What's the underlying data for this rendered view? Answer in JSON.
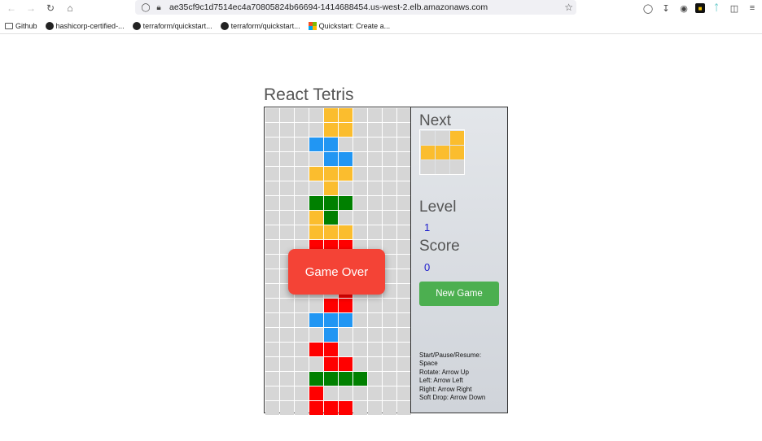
{
  "browser": {
    "url": "ae35cf9c1d7514ec4a70805824b66694-1414688454.us-west-2.elb.amazonaws.com",
    "bookmarks": [
      {
        "label": "Github",
        "icon": "folder-icon"
      },
      {
        "label": "hashicorp-certified-...",
        "icon": "github-icon"
      },
      {
        "label": "terraform/quickstart...",
        "icon": "github-icon"
      },
      {
        "label": "terraform/quickstart...",
        "icon": "github-icon"
      },
      {
        "label": "Quickstart: Create a...",
        "icon": "microsoft-icon"
      }
    ]
  },
  "game": {
    "title": "React Tetris",
    "next_label": "Next",
    "level_label": "Level",
    "level_value": "1",
    "score_label": "Score",
    "score_value": "0",
    "new_game_label": "New Game",
    "game_over_label": "Game Over",
    "controls": [
      "Start/Pause/Resume:",
      "Space",
      "Rotate: Arrow Up",
      "Left: Arrow Left",
      "Right: Arrow Right",
      "Soft Drop: Arrow Down"
    ]
  },
  "colors": {
    "empty": "#d6d6d6",
    "yellow": "#fbbd2e",
    "blue": "#2196f3",
    "green": "#008000",
    "red": "#ff0000"
  },
  "board": {
    "cols": 10,
    "rows": 21,
    "cells": [
      "....YY....",
      "....YY....",
      "...BB.....",
      "....BB....",
      "...YYY....",
      "....Y.....",
      "...GGG....",
      "...YG.....",
      "...YYY....",
      "...RRR....",
      "...RR.....",
      "...RRR....",
      ".....R....",
      "....RR....",
      "...BBB....",
      "....B.....",
      "...RR.....",
      "....RR....",
      "...GGGG...",
      "...R......",
      "...RRR...."
    ]
  },
  "next_piece": {
    "cells": [
      "..Y",
      "YYY",
      "..."
    ]
  }
}
